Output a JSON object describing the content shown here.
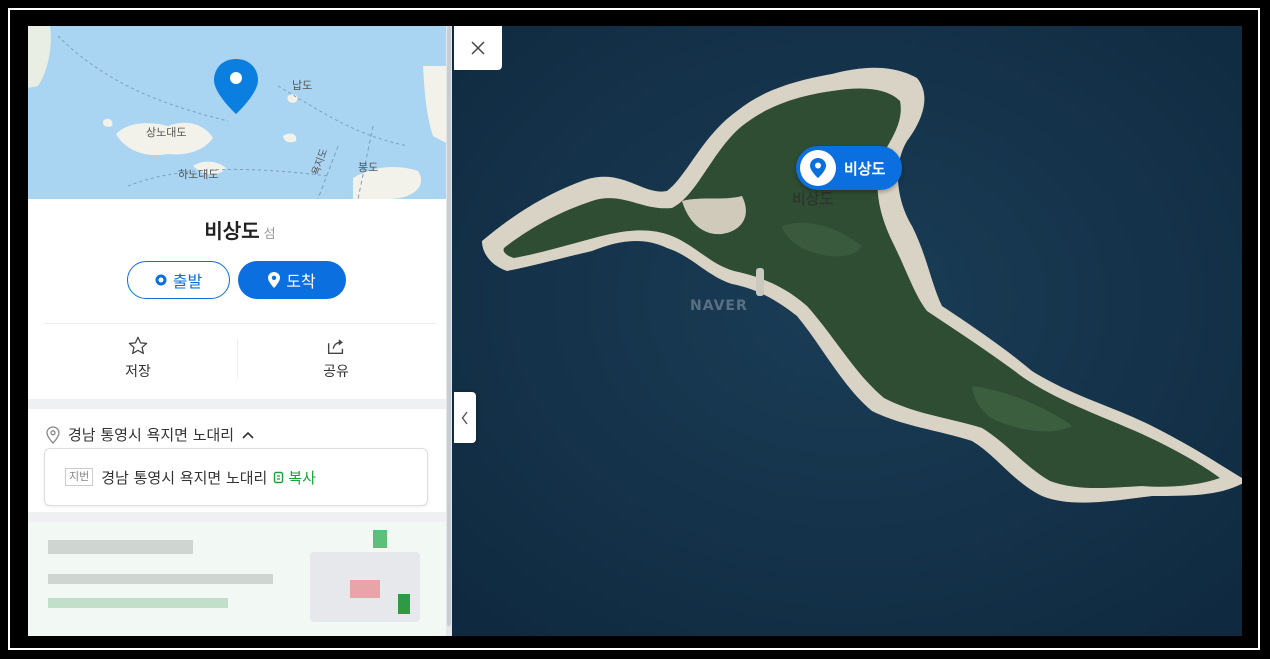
{
  "place": {
    "name": "비상도",
    "category": "섬"
  },
  "buttons": {
    "start_label": "출발",
    "arrive_label": "도착"
  },
  "actions": {
    "save_label": "저장",
    "share_label": "공유"
  },
  "address": {
    "road": "경남 통영시 욕지면 노대리",
    "lot_tag": "지번",
    "lot": "경남 통영시 욕지면 노대리",
    "copy_label": "복사"
  },
  "minimap": {
    "labels": [
      "납도",
      "상노대도",
      "하노대도",
      "봉도",
      "욕지도"
    ]
  },
  "map": {
    "marker_label": "비상도",
    "island_label": "비상도",
    "watermark": "NAVER"
  },
  "colors": {
    "accent": "#0b6fe0",
    "copy_green": "#1aa23a",
    "sea": "#13324a"
  }
}
